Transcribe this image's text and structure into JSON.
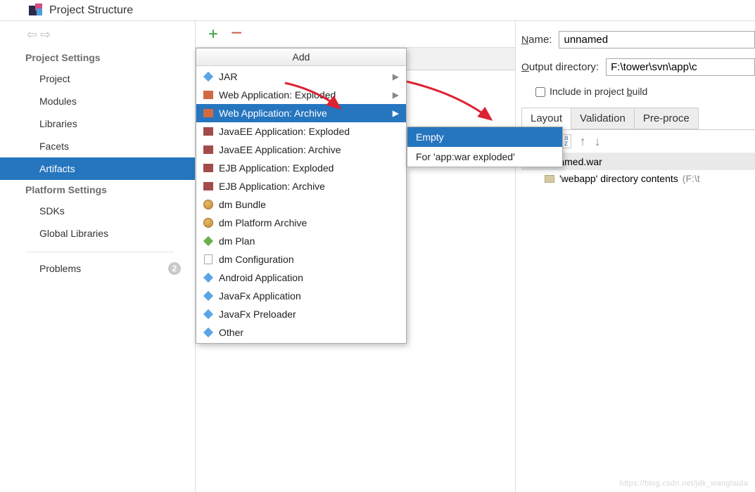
{
  "title": "Project Structure",
  "nav": {
    "back": "⇦",
    "forward": "⇨"
  },
  "sidebar": {
    "section1": "Project Settings",
    "items1": [
      "Project",
      "Modules",
      "Libraries",
      "Facets",
      "Artifacts"
    ],
    "selected1": 4,
    "section2": "Platform Settings",
    "items2": [
      "SDKs",
      "Global Libraries"
    ],
    "problems": "Problems",
    "problems_count": "2"
  },
  "addmenu": {
    "header": "Add",
    "items": [
      {
        "label": "JAR",
        "sub": true
      },
      {
        "label": "Web Application: Exploded",
        "sub": true
      },
      {
        "label": "Web Application: Archive",
        "sub": true,
        "highlight": true
      },
      {
        "label": "JavaEE Application: Exploded"
      },
      {
        "label": "JavaEE Application: Archive"
      },
      {
        "label": "EJB Application: Exploded"
      },
      {
        "label": "EJB Application: Archive"
      },
      {
        "label": "dm Bundle"
      },
      {
        "label": "dm Platform Archive"
      },
      {
        "label": "dm Plan"
      },
      {
        "label": "dm Configuration"
      },
      {
        "label": "Android Application"
      },
      {
        "label": "JavaFx Application"
      },
      {
        "label": "JavaFx Preloader"
      },
      {
        "label": "Other"
      }
    ]
  },
  "submenu": {
    "items": [
      "Empty",
      "For 'app:war exploded'"
    ],
    "highlight": 0
  },
  "right": {
    "name_label": "Name:",
    "name_value": "unnamed",
    "outdir_label": "Output directory:",
    "outdir_value": "F:\\tower\\svn\\app\\c",
    "include_label_pre": "Include in project ",
    "include_label_u": "b",
    "include_label_post": "uild",
    "tabs": [
      "Layout",
      "Validation",
      "Pre-proce"
    ],
    "active_tab": 0,
    "sort_label": "a\nz",
    "tree": {
      "root": "unnamed.war",
      "child": "'webapp' directory contents",
      "child_suffix": " (F:\\t"
    }
  },
  "watermark": "https://blog.csdn.net/jdk_wangtaida"
}
